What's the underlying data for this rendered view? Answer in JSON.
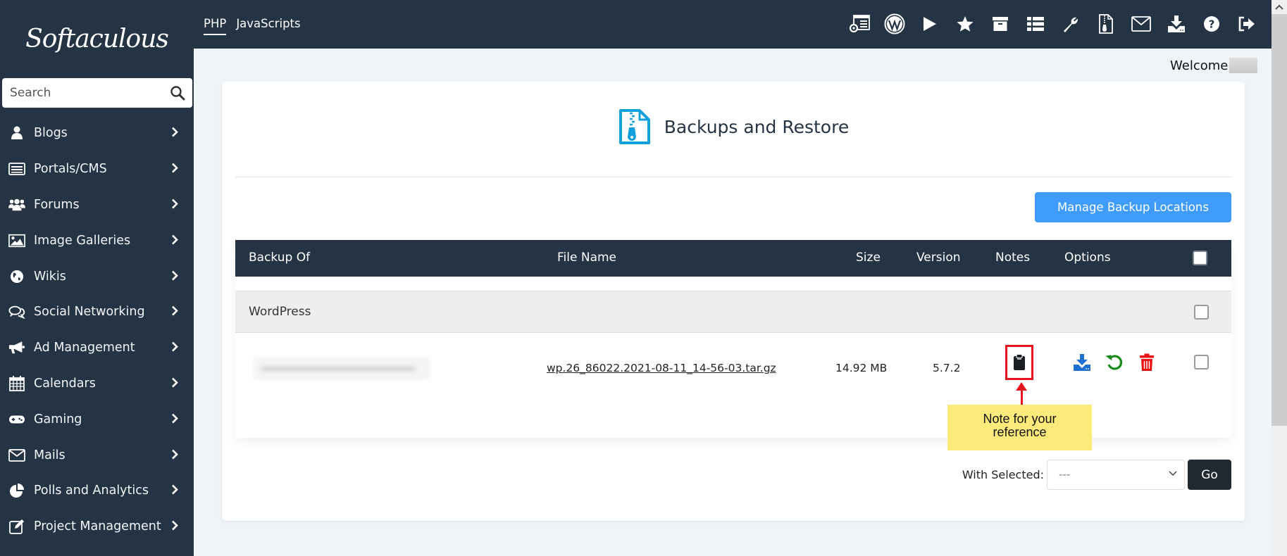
{
  "app": {
    "logo_text": "Softaculous"
  },
  "sidebar": {
    "search_placeholder": "Search",
    "items": [
      {
        "label": "Blogs",
        "icon": "user-icon"
      },
      {
        "label": "Portals/CMS",
        "icon": "list-icon"
      },
      {
        "label": "Forums",
        "icon": "users-icon"
      },
      {
        "label": "Image Galleries",
        "icon": "image-icon"
      },
      {
        "label": "Wikis",
        "icon": "globe-icon"
      },
      {
        "label": "Social Networking",
        "icon": "comments-icon"
      },
      {
        "label": "Ad Management",
        "icon": "bullhorn-icon"
      },
      {
        "label": "Calendars",
        "icon": "calendar-icon"
      },
      {
        "label": "Gaming",
        "icon": "gamepad-icon"
      },
      {
        "label": "Mails",
        "icon": "envelope-icon"
      },
      {
        "label": "Polls and Analytics",
        "icon": "pie-chart-icon"
      },
      {
        "label": "Project Management",
        "icon": "edit-icon"
      }
    ]
  },
  "topbar": {
    "tabs": [
      {
        "label": "PHP",
        "active": true
      },
      {
        "label": "JavaScripts",
        "active": false
      }
    ],
    "toolbar_icons": [
      "admin-panel-icon",
      "wordpress-icon",
      "play-icon",
      "star-icon",
      "archive-icon",
      "list-icon",
      "wrench-icon",
      "backup-file-icon",
      "envelope-icon",
      "download-icon",
      "help-icon",
      "logout-icon"
    ]
  },
  "welcome": {
    "text": "Welcome"
  },
  "page": {
    "title": "Backups and Restore",
    "manage_button": "Manage Backup Locations",
    "table": {
      "headers": [
        "Backup Of",
        "File Name",
        "Size",
        "Version",
        "Notes",
        "Options"
      ],
      "groups": [
        {
          "name": "WordPress",
          "rows": [
            {
              "backup_of": "[blurred]",
              "file_name": "wp.26_86022.2021-08-11_14-56-03.tar.gz",
              "size": "14.92 MB",
              "version": "5.7.2",
              "notes_icon": "clipboard-icon",
              "options": [
                "download-icon",
                "restore-icon",
                "delete-icon"
              ]
            }
          ]
        }
      ]
    },
    "bulk": {
      "label": "With Selected:",
      "selected": "---",
      "go_label": "Go"
    }
  },
  "annotation": {
    "text_line1": "Note for your",
    "text_line2": "reference"
  },
  "colors": {
    "sidebar_bg": "#253444",
    "accent_blue": "#3f9cfb",
    "annotation_red": "#e8141d",
    "note_yellow": "#fdea7b",
    "restore_green": "#1a8a1a",
    "delete_red": "#ee1111",
    "download_blue": "#1e6fcf"
  }
}
